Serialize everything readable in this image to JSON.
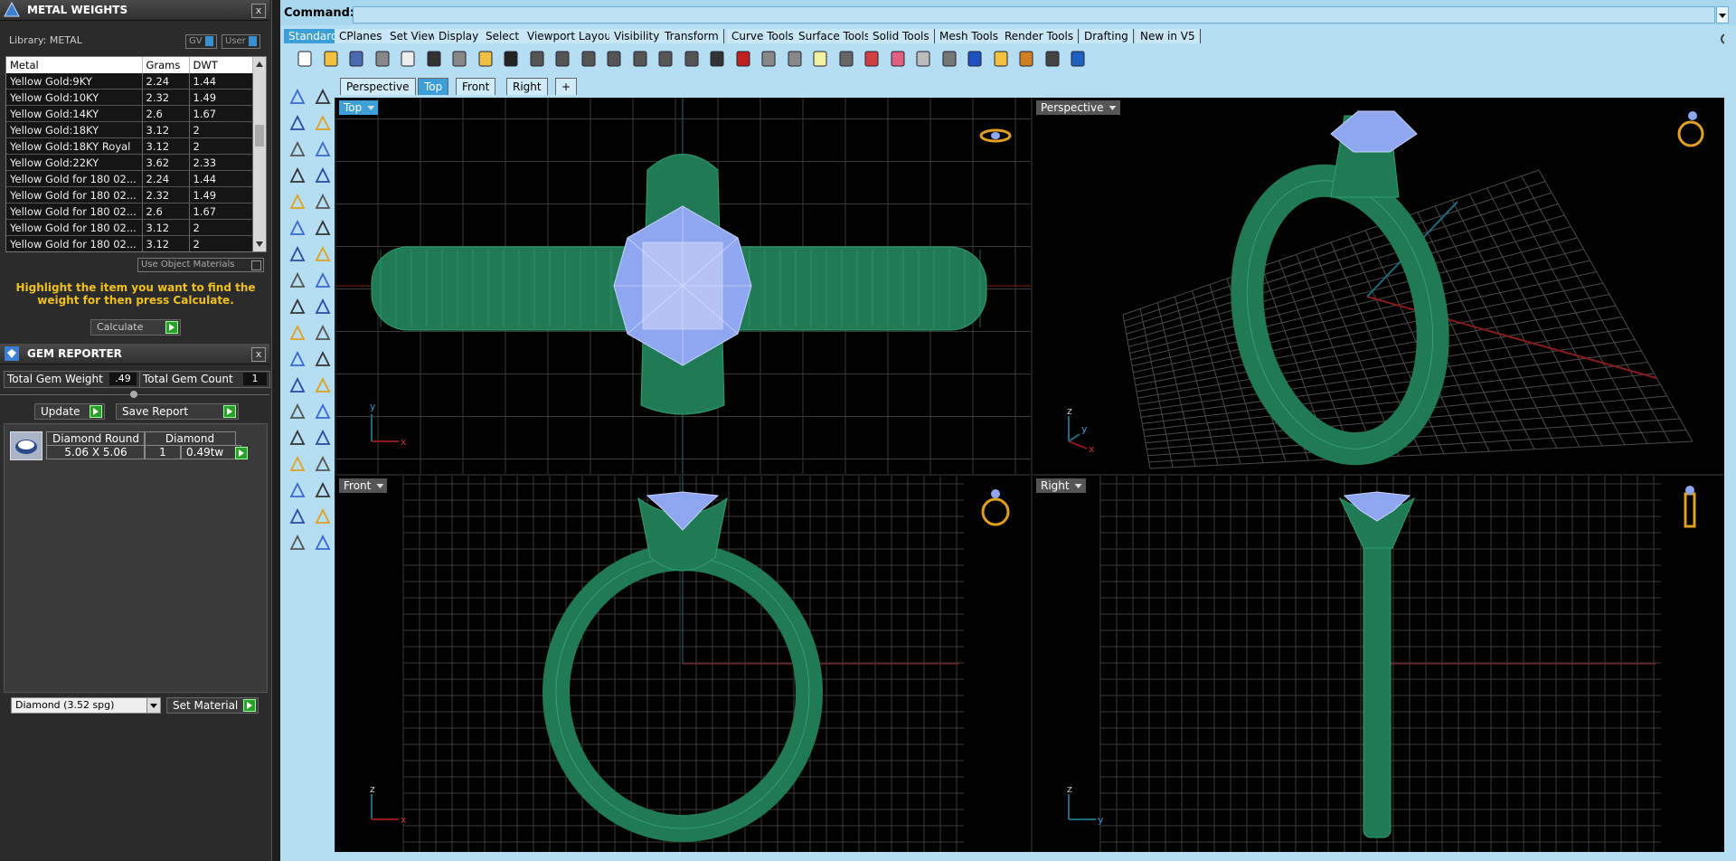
{
  "metal_panel": {
    "title": "METAL WEIGHTS",
    "close": "x",
    "library_label": "Library: METAL",
    "gv_label": "GV",
    "user_label": "User",
    "columns": [
      "Metal",
      "Grams",
      "DWT"
    ],
    "rows": [
      [
        "Yellow Gold:9KY",
        "2.24",
        "1.44"
      ],
      [
        "Yellow Gold:10KY",
        "2.32",
        "1.49"
      ],
      [
        "Yellow Gold:14KY",
        "2.6",
        "1.67"
      ],
      [
        "Yellow Gold:18KY",
        "3.12",
        "2"
      ],
      [
        "Yellow Gold:18KY Royal",
        "3.12",
        "2"
      ],
      [
        "Yellow Gold:22KY",
        "3.62",
        "2.33"
      ],
      [
        "Yellow Gold for 180 02...",
        "2.24",
        "1.44"
      ],
      [
        "Yellow Gold for 180 02...",
        "2.32",
        "1.49"
      ],
      [
        "Yellow Gold for 180 02...",
        "2.6",
        "1.67"
      ],
      [
        "Yellow Gold for 180 02...",
        "3.12",
        "2"
      ],
      [
        "Yellow Gold for 180 02...",
        "3.12",
        "2"
      ]
    ],
    "use_object_materials": "Use Object Materials",
    "instruction": "Highlight the item you want to find the weight for then press Calculate.",
    "calculate_label": "Calculate"
  },
  "gem_panel": {
    "title": "GEM REPORTER",
    "close": "x",
    "total_weight_label": "Total Gem Weight",
    "total_weight_value": ".49",
    "total_count_label": "Total Gem Count",
    "total_count_value": "1",
    "update_label": "Update",
    "save_report_label": "Save Report",
    "gem": {
      "shape": "Diamond Round",
      "material": "Diamond",
      "size": "5.06 X 5.06",
      "count": "1",
      "weight": "0.49tw"
    },
    "material_select": "Diamond    (3.52 spg)",
    "set_material_label": "Set Material"
  },
  "command": {
    "label": "Command:",
    "value": ""
  },
  "toolbar_tabs": [
    "Standard",
    "CPlanes",
    "Set View",
    "Display",
    "Select",
    "Viewport Layout",
    "Visibility",
    "Transform",
    "Curve Tools",
    "Surface Tools",
    "Solid Tools",
    "Mesh Tools",
    "Render Tools",
    "Drafting",
    "New in V5"
  ],
  "active_toolbar_tab": "Standard",
  "view_tabs": [
    "Perspective",
    "Top",
    "Front",
    "Right",
    "+"
  ],
  "active_view_tab": "Top",
  "viewports": {
    "top": {
      "label": "Top"
    },
    "perspective": {
      "label": "Perspective"
    },
    "front": {
      "label": "Front"
    },
    "right": {
      "label": "Right"
    }
  },
  "axis": {
    "x": "x",
    "y": "y",
    "z": "z"
  },
  "colors": {
    "ring": "#1f7a55",
    "gem": "#8fa6f0",
    "viewport_bg": "#000000",
    "frame": "#b5def3",
    "active_tab": "#3c9fd8",
    "instruction": "#f0c020"
  }
}
